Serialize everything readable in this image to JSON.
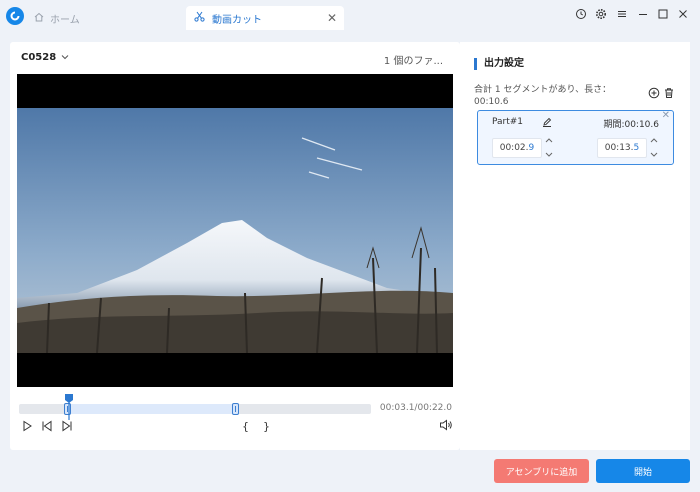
{
  "titlebar": {
    "tabs": [
      {
        "label": "ホーム",
        "icon": "home-icon"
      },
      {
        "label": "動画カット",
        "icon": "scissors-icon"
      }
    ],
    "window_controls": [
      "history-icon",
      "gear-icon",
      "menu-icon",
      "minimize-icon",
      "maximize-icon",
      "close-icon"
    ]
  },
  "player": {
    "clip_name": "C0528",
    "file_count": "1 個のファ...",
    "time_readout": "00:03.1/00:22.0",
    "playback_progress": 0.141,
    "selection": {
      "start": 0.132,
      "end": 0.618
    },
    "controls": [
      "play-icon",
      "previous-frame-icon",
      "next-frame-icon"
    ],
    "bracket_open": "{",
    "bracket_close": "}"
  },
  "output": {
    "title": "出力設定",
    "summary": "合計 1 セグメントがあり、長さ：00:10.6",
    "segment": {
      "name": "Part#1",
      "duration": "期間:00:10.6",
      "start_main": "00:02.",
      "start_digit": "9",
      "end_main": "00:13.",
      "end_digit": "5"
    }
  },
  "buttons": {
    "add_to_assembly": "アセンブリに追加",
    "start": "開始"
  },
  "colors": {
    "accent": "#1687e8",
    "add_button": "#f47a73",
    "segment_border": "#3d8be0"
  }
}
